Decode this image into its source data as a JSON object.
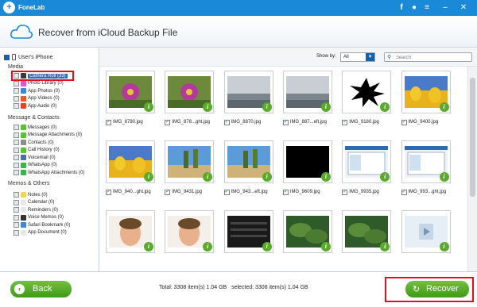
{
  "titlebar": {
    "app_name": "FoneLab",
    "icons": [
      "facebook-icon",
      "chat-icon",
      "menu-icon",
      "minimize-icon",
      "close-icon"
    ]
  },
  "header": {
    "title": "Recover from iCloud Backup File"
  },
  "sidebar": {
    "device": "User's iPhone",
    "sections": [
      {
        "title": "Media",
        "items": [
          {
            "label": "Camera Roll (33)",
            "icon": "camera-roll-icon",
            "color": "#3a3a3a",
            "selected": true
          },
          {
            "label": "Photo Library (0)",
            "icon": "photo-library-icon",
            "color": "#d85ad0"
          },
          {
            "label": "App Photos (0)",
            "icon": "app-photos-icon",
            "color": "#3f86d8"
          },
          {
            "label": "App Videos (0)",
            "icon": "app-videos-icon",
            "color": "#e45a2a"
          },
          {
            "label": "App Audio (0)",
            "icon": "app-audio-icon",
            "color": "#e0462a"
          }
        ]
      },
      {
        "title": "Message & Contacts",
        "items": [
          {
            "label": "Messages (0)",
            "icon": "messages-icon",
            "color": "#5bbf3a"
          },
          {
            "label": "Message Attachments (0)",
            "icon": "message-attachments-icon",
            "color": "#5bbf3a"
          },
          {
            "label": "Contacts (0)",
            "icon": "contacts-icon",
            "color": "#8c8c8c"
          },
          {
            "label": "Call History (0)",
            "icon": "call-history-icon",
            "color": "#5bbf3a"
          },
          {
            "label": "Voicemail (0)",
            "icon": "voicemail-icon",
            "color": "#4a6fa8"
          },
          {
            "label": "WhatsApp (0)",
            "icon": "whatsapp-icon",
            "color": "#3cb44a"
          },
          {
            "label": "WhatsApp Attachments (0)",
            "icon": "whatsapp-attachments-icon",
            "color": "#3cb44a"
          }
        ]
      },
      {
        "title": "Memos & Others",
        "items": [
          {
            "label": "Notes (0)",
            "icon": "notes-icon",
            "color": "#f2d25a"
          },
          {
            "label": "Calendar (0)",
            "icon": "calendar-icon",
            "color": "#e8e8e8"
          },
          {
            "label": "Reminders (0)",
            "icon": "reminders-icon",
            "color": "#e8e8e8"
          },
          {
            "label": "Voice Memos (0)",
            "icon": "voice-memos-icon",
            "color": "#333333"
          },
          {
            "label": "Safari Bookmark (0)",
            "icon": "safari-bookmark-icon",
            "color": "#3f86d8"
          },
          {
            "label": "App Document (0)",
            "icon": "app-document-icon",
            "color": "#e8e8e8"
          }
        ]
      }
    ]
  },
  "toolbar": {
    "show_by_label": "Show by:",
    "show_by_value": "All",
    "search_placeholder": "Search"
  },
  "grid": {
    "items": [
      {
        "name": "IMG_8780.jpg",
        "thumb": "purple-flower"
      },
      {
        "name": "IMG_878...ght.jpg",
        "thumb": "purple-flower"
      },
      {
        "name": "IMG_8870.jpg",
        "thumb": "landscape-gray"
      },
      {
        "name": "IMG_887...eft.jpg",
        "thumb": "landscape-gray"
      },
      {
        "name": "IMG_9180.jpg",
        "thumb": "black-splat"
      },
      {
        "name": "IMG_9400.jpg",
        "thumb": "tulips"
      },
      {
        "name": "IMG_940...ght.jpg",
        "thumb": "tulips"
      },
      {
        "name": "IMG_9431.jpg",
        "thumb": "beach-trees"
      },
      {
        "name": "IMG_943...eft.jpg",
        "thumb": "beach-trees"
      },
      {
        "name": "IMG_9609.jpg",
        "thumb": "black"
      },
      {
        "name": "IMG_9935.jpg",
        "thumb": "screenshot"
      },
      {
        "name": "IMG_993...ght.jpg",
        "thumb": "screenshot"
      },
      {
        "name": "",
        "thumb": "baby"
      },
      {
        "name": "",
        "thumb": "baby"
      },
      {
        "name": "",
        "thumb": "dark-ui"
      },
      {
        "name": "",
        "thumb": "leaves"
      },
      {
        "name": "",
        "thumb": "leaves"
      },
      {
        "name": "",
        "thumb": "video"
      }
    ]
  },
  "footer": {
    "back_label": "Back",
    "total_text": "Total: 3308 item(s) 1.04 GB",
    "selected_text": "selected: 3308 item(s) 1.04 GB",
    "recover_label": "Recover"
  },
  "colors": {
    "titlebar": "#1a8ad8",
    "accent": "#1b5fa8",
    "button_green": "#4caf20",
    "highlight_red": "#e0111b"
  }
}
